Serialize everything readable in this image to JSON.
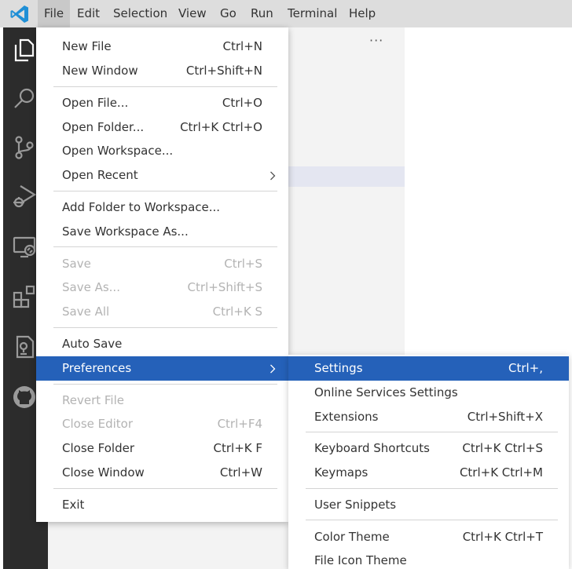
{
  "menubar": {
    "items": [
      "File",
      "Edit",
      "Selection",
      "View",
      "Go",
      "Run",
      "Terminal",
      "Help"
    ]
  },
  "activitybar": {
    "icons": [
      "explorer-icon",
      "search-icon",
      "source-control-icon",
      "run-debug-icon",
      "remote-explorer-icon",
      "extensions-icon",
      "test-icon",
      "github-icon"
    ]
  },
  "sidebar": {
    "more_label": "···"
  },
  "file_menu": {
    "items": [
      {
        "label": "New File",
        "key": "Ctrl+N"
      },
      {
        "label": "New Window",
        "key": "Ctrl+Shift+N"
      },
      {
        "label": "Open File...",
        "key": "Ctrl+O"
      },
      {
        "label": "Open Folder...",
        "key": "Ctrl+K Ctrl+O"
      },
      {
        "label": "Open Workspace...",
        "key": ""
      },
      {
        "label": "Open Recent",
        "key": ""
      },
      {
        "label": "Add Folder to Workspace...",
        "key": ""
      },
      {
        "label": "Save Workspace As...",
        "key": ""
      },
      {
        "label": "Save",
        "key": "Ctrl+S"
      },
      {
        "label": "Save As...",
        "key": "Ctrl+Shift+S"
      },
      {
        "label": "Save All",
        "key": "Ctrl+K S"
      },
      {
        "label": "Auto Save",
        "key": ""
      },
      {
        "label": "Preferences",
        "key": ""
      },
      {
        "label": "Revert File",
        "key": ""
      },
      {
        "label": "Close Editor",
        "key": "Ctrl+F4"
      },
      {
        "label": "Close Folder",
        "key": "Ctrl+K F"
      },
      {
        "label": "Close Window",
        "key": "Ctrl+W"
      },
      {
        "label": "Exit",
        "key": ""
      }
    ]
  },
  "prefs_menu": {
    "items": [
      {
        "label": "Settings",
        "key": "Ctrl+,"
      },
      {
        "label": "Online Services Settings",
        "key": ""
      },
      {
        "label": "Extensions",
        "key": "Ctrl+Shift+X"
      },
      {
        "label": "Keyboard Shortcuts",
        "key": "Ctrl+K Ctrl+S"
      },
      {
        "label": "Keymaps",
        "key": "Ctrl+K Ctrl+M"
      },
      {
        "label": "User Snippets",
        "key": ""
      },
      {
        "label": "Color Theme",
        "key": "Ctrl+K Ctrl+T"
      },
      {
        "label": "File Icon Theme",
        "key": ""
      }
    ]
  },
  "colors": {
    "menubar_bg": "#dddddd",
    "activitybar_bg": "#2c2c2c",
    "sidebar_bg": "#f3f3f3",
    "selection": "#2561b9",
    "disabled_text": "#b3b3b3",
    "logo_blue": "#007acc"
  }
}
